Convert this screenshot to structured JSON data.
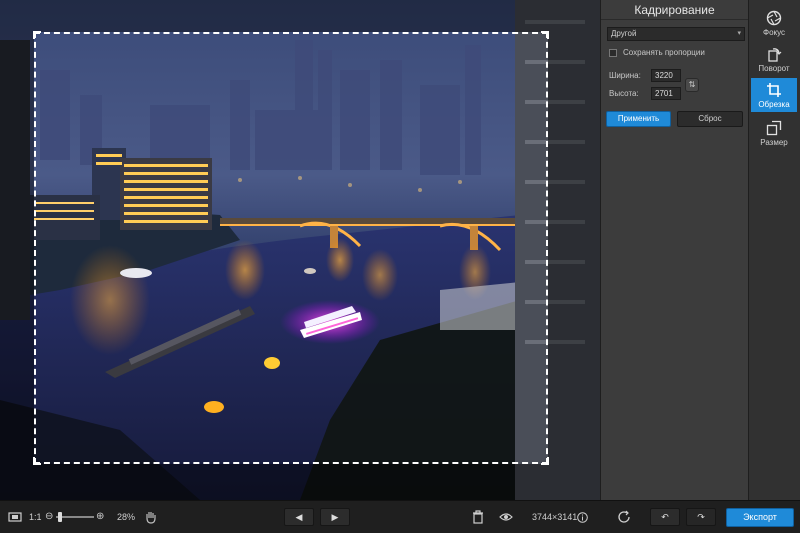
{
  "panel": {
    "title": "Кадрирование",
    "preset_value": "Другой",
    "keep_ratio_label": "Сохранять пропорции",
    "width_label": "Ширина:",
    "width_value": "3220",
    "height_label": "Высота:",
    "height_value": "2701",
    "apply_label": "Применить",
    "reset_label": "Сброс"
  },
  "tools": [
    {
      "label": "Фокус",
      "icon": "aperture-icon"
    },
    {
      "label": "Поворот",
      "icon": "rotate-icon"
    },
    {
      "label": "Обрезка",
      "icon": "crop-icon",
      "active": true
    },
    {
      "label": "Размер",
      "icon": "resize-icon"
    }
  ],
  "bottombar": {
    "actual_size_label": "1:1",
    "zoom_percent": "28%",
    "image_size": "3744×3141",
    "export_label": "Экспорт"
  },
  "colors": {
    "accent": "#1f8ad8",
    "panel_bg": "#3c3c3c",
    "toolbar_bg": "#1f1f1f"
  }
}
